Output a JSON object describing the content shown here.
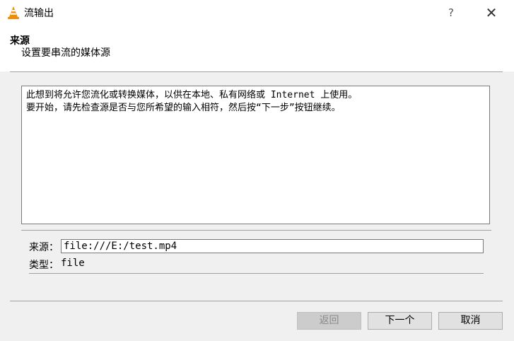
{
  "window": {
    "title": "流输出",
    "help": "?",
    "close": "✕"
  },
  "header": {
    "title": "来源",
    "subtitle": "设置要串流的媒体源"
  },
  "description": {
    "line1": "此想到将允许您流化或转换媒体，以供在本地、私有网络或 Internet 上使用。",
    "line2": "要开始，请先检查源是否与您所希望的输入相符，然后按“下一步”按钮继续。"
  },
  "source": {
    "label": "来源：",
    "value": "file:///E:/test.mp4"
  },
  "type": {
    "label": "类型：",
    "value": "file"
  },
  "buttons": {
    "back": "返回",
    "next": "下一个",
    "cancel": "取消"
  }
}
